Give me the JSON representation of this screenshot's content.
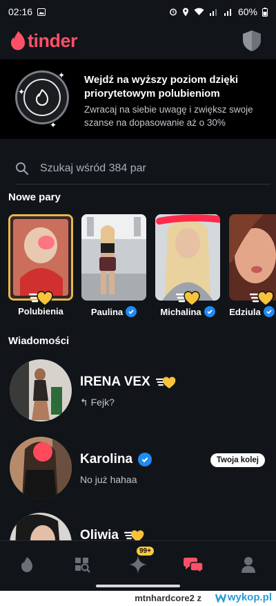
{
  "status_bar": {
    "time": "02:16",
    "battery": "60%"
  },
  "app": {
    "brand": "tinder",
    "brand_color": "#fd5068"
  },
  "promo": {
    "title": "Wejdź na wyższy poziom dzięki priorytetowym polubieniom",
    "subtitle": "Zwracaj na siebie uwagę i zwiększ swoje szanse na dopasowanie aż o 30%"
  },
  "search": {
    "placeholder": "Szukaj wśród 384 par"
  },
  "new_matches": {
    "title": "Nowe pary",
    "items": [
      {
        "name": "Polubienia",
        "verified": false
      },
      {
        "name": "Paulina",
        "verified": true
      },
      {
        "name": "Michalina",
        "verified": true
      },
      {
        "name": "Edziula",
        "verified": true
      }
    ]
  },
  "messages": {
    "title": "Wiadomości",
    "items": [
      {
        "name": "IRENA VEX",
        "preview": "Fejk?",
        "reply_icon": "reply-arrow-icon",
        "verified": false,
        "badge": ""
      },
      {
        "name": "Karolina",
        "preview": "No już hahaa",
        "verified": true,
        "badge": "Twoja kolej"
      },
      {
        "name": "Oliwia",
        "preview": "",
        "verified": false,
        "badge": ""
      }
    ]
  },
  "tabbar": {
    "items": [
      "flame-icon",
      "explore-icon",
      "spark-icon",
      "chat-icon",
      "profile-icon"
    ],
    "spark_badge": "99+",
    "active": "chat-icon"
  },
  "watermark": {
    "user": "mtnhardcore2  z",
    "site": "wykop.pl"
  }
}
